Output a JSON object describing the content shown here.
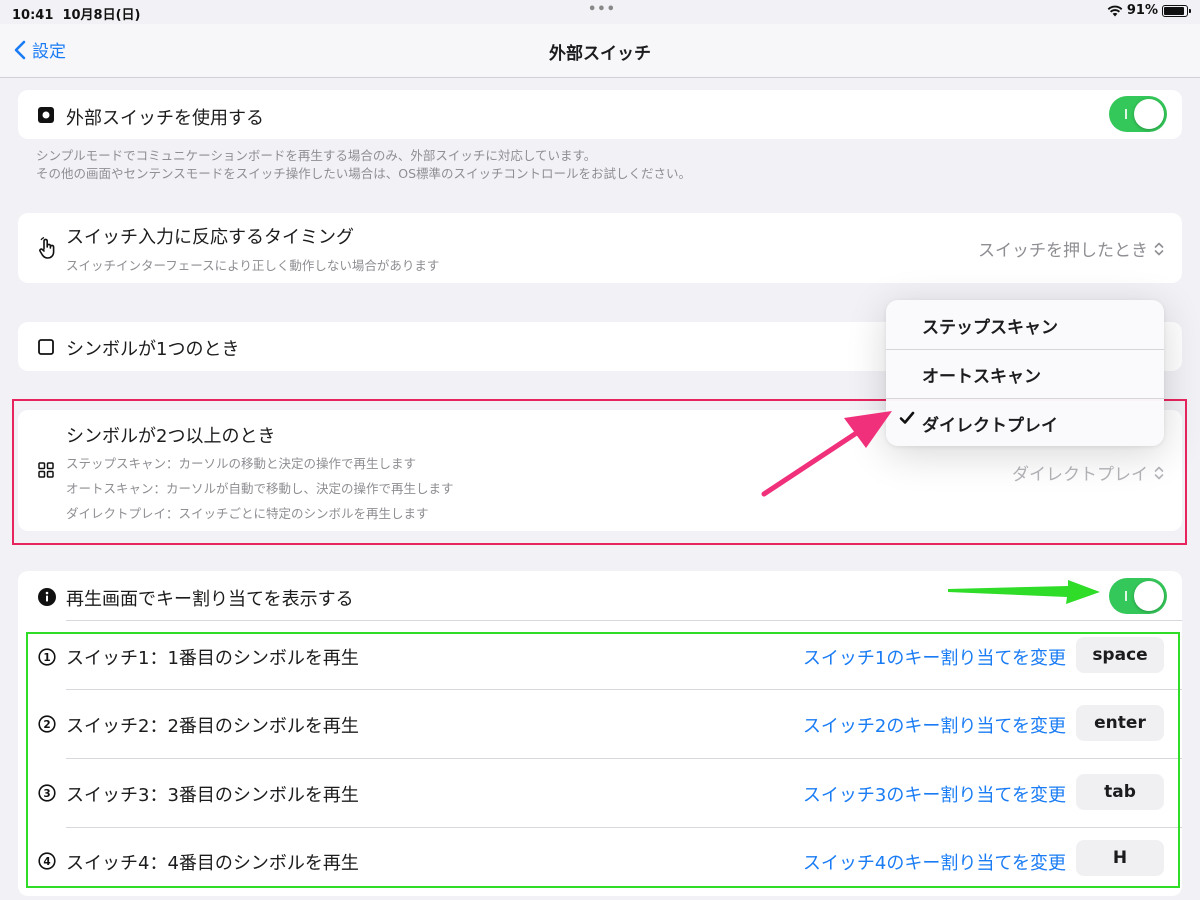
{
  "status_bar": {
    "time": "10:41",
    "date": "10月8日(日)",
    "battery": "91%",
    "battery_fraction": 0.91
  },
  "nav": {
    "back_label": "設定",
    "title": "外部スイッチ"
  },
  "use_switch": {
    "label": "外部スイッチを使用する",
    "enabled": true
  },
  "footnote": {
    "line1": "シンプルモードでコミュニケーションボードを再生する場合のみ、外部スイッチに対応しています。",
    "line2": "その他の画面やセンテンスモードをスイッチ操作したい場合は、OS標準のスイッチコントロールをお試しください。"
  },
  "timing": {
    "label": "スイッチ入力に反応するタイミング",
    "sub": "スイッチインターフェースにより正しく動作しない場合があります",
    "value": "スイッチを押したとき"
  },
  "one_symbol": {
    "label": "シンボルが1つのとき"
  },
  "multi_symbol": {
    "label": "シンボルが2つ以上のとき",
    "desc1": "ステップスキャン：カーソルの移動と決定の操作で再生します",
    "desc2": "オートスキャン：カーソルが自動で移動し、決定の操作で再生します",
    "desc3": "ダイレクトプレイ：スイッチごとに特定のシンボルを再生します",
    "value": "ダイレクトプレイ"
  },
  "menu": {
    "items": [
      {
        "label": "ステップスキャン",
        "selected": false
      },
      {
        "label": "オートスキャン",
        "selected": false
      },
      {
        "label": "ダイレクトプレイ",
        "selected": true
      }
    ]
  },
  "show_keys": {
    "label": "再生画面でキー割り当てを表示する",
    "enabled": true
  },
  "switches": [
    {
      "num": "1",
      "label": "スイッチ1：1番目のシンボルを再生",
      "link": "スイッチ1のキー割り当てを変更",
      "key": "space"
    },
    {
      "num": "2",
      "label": "スイッチ2：2番目のシンボルを再生",
      "link": "スイッチ2のキー割り当てを変更",
      "key": "enter"
    },
    {
      "num": "3",
      "label": "スイッチ3：3番目のシンボルを再生",
      "link": "スイッチ3のキー割り当てを変更",
      "key": "tab"
    },
    {
      "num": "4",
      "label": "スイッチ4：4番目のシンボルを再生",
      "link": "スイッチ4のキー割り当てを変更",
      "key": "H"
    }
  ],
  "colors": {
    "accent": "#1a7cf4",
    "toggle_on": "#34c759",
    "highlight_red": "#e8245f",
    "highlight_green": "#2fdc28"
  }
}
